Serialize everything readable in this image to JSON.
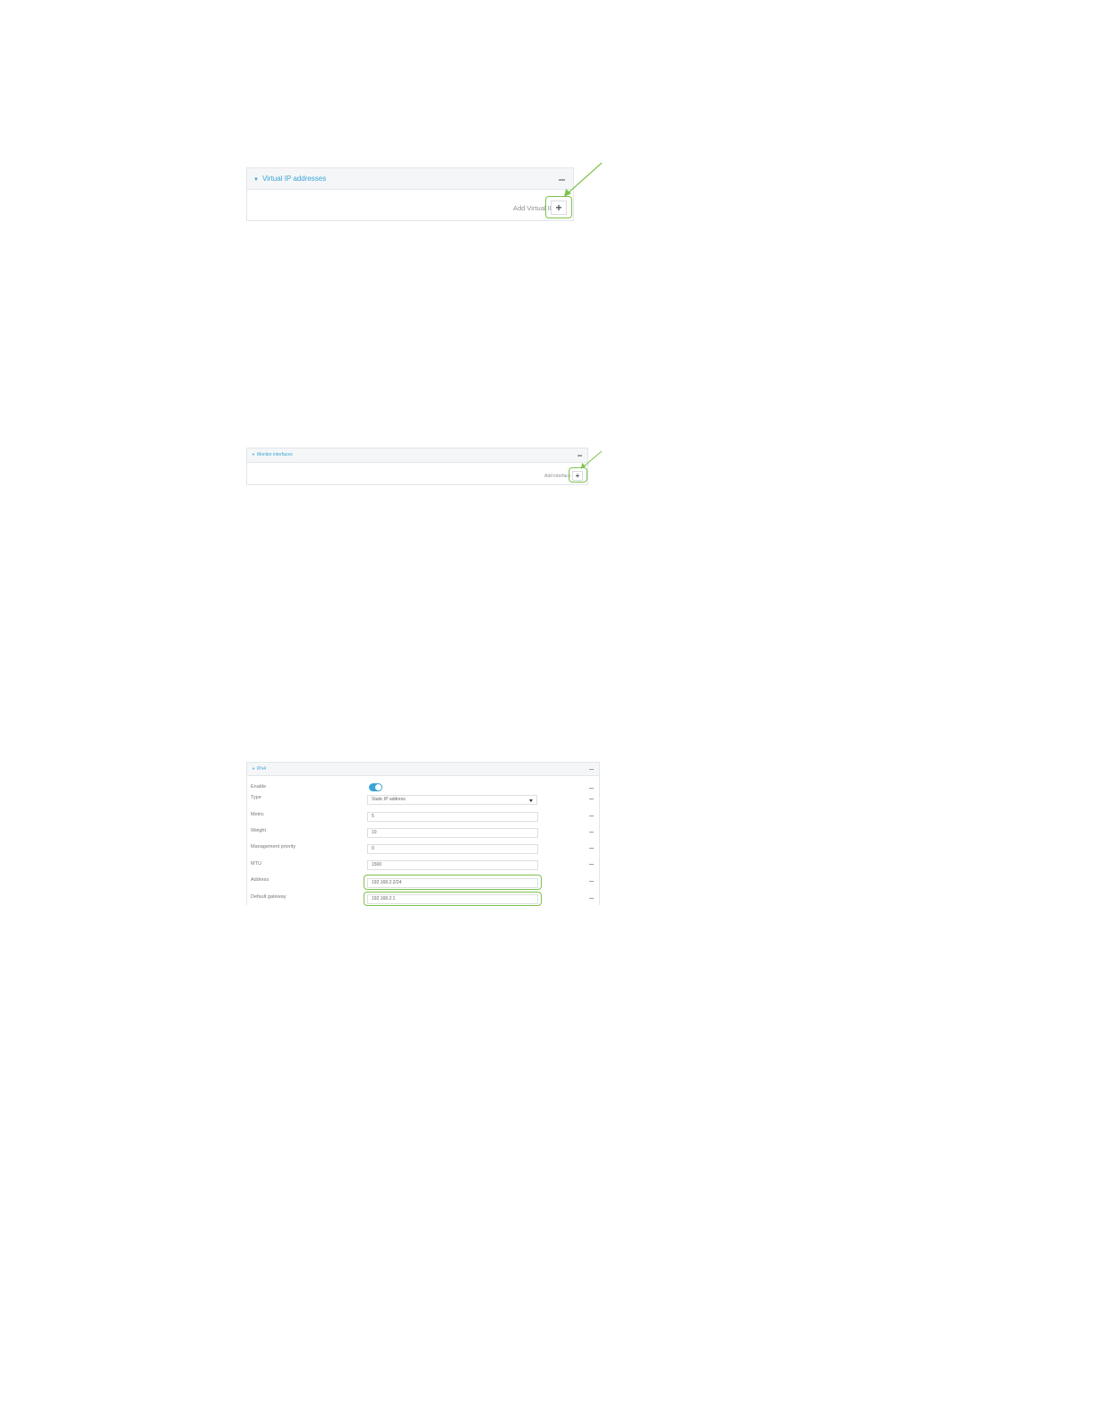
{
  "virtual_ip_panel": {
    "title": "Virtual IP addresses",
    "add_label": "Add Virtual IP",
    "add_icon": "plus-icon"
  },
  "monitor_panel": {
    "title": "Monitor interfaces",
    "add_label": "Add interface",
    "add_icon": "plus-icon"
  },
  "ipv4_panel": {
    "title": "IPv4",
    "rows": [
      {
        "label": "Enable",
        "kind": "toggle",
        "value": ""
      },
      {
        "label": "Type",
        "kind": "select",
        "value": "Static IP address"
      },
      {
        "label": "Metric",
        "kind": "input",
        "value": "5"
      },
      {
        "label": "Weight",
        "kind": "input",
        "value": "10"
      },
      {
        "label": "Management priority",
        "kind": "input",
        "value": "0"
      },
      {
        "label": "MTU",
        "kind": "input",
        "value": "1500"
      },
      {
        "label": "Address",
        "kind": "input",
        "value": "192.168.2.2/24"
      },
      {
        "label": "Default gateway",
        "kind": "input",
        "value": "192.168.2.1"
      }
    ]
  },
  "colors": {
    "accent": "#3aa5d6",
    "highlight": "#7dc24b",
    "panel_header": "#f4f6f8",
    "border": "#e3e6ea"
  }
}
